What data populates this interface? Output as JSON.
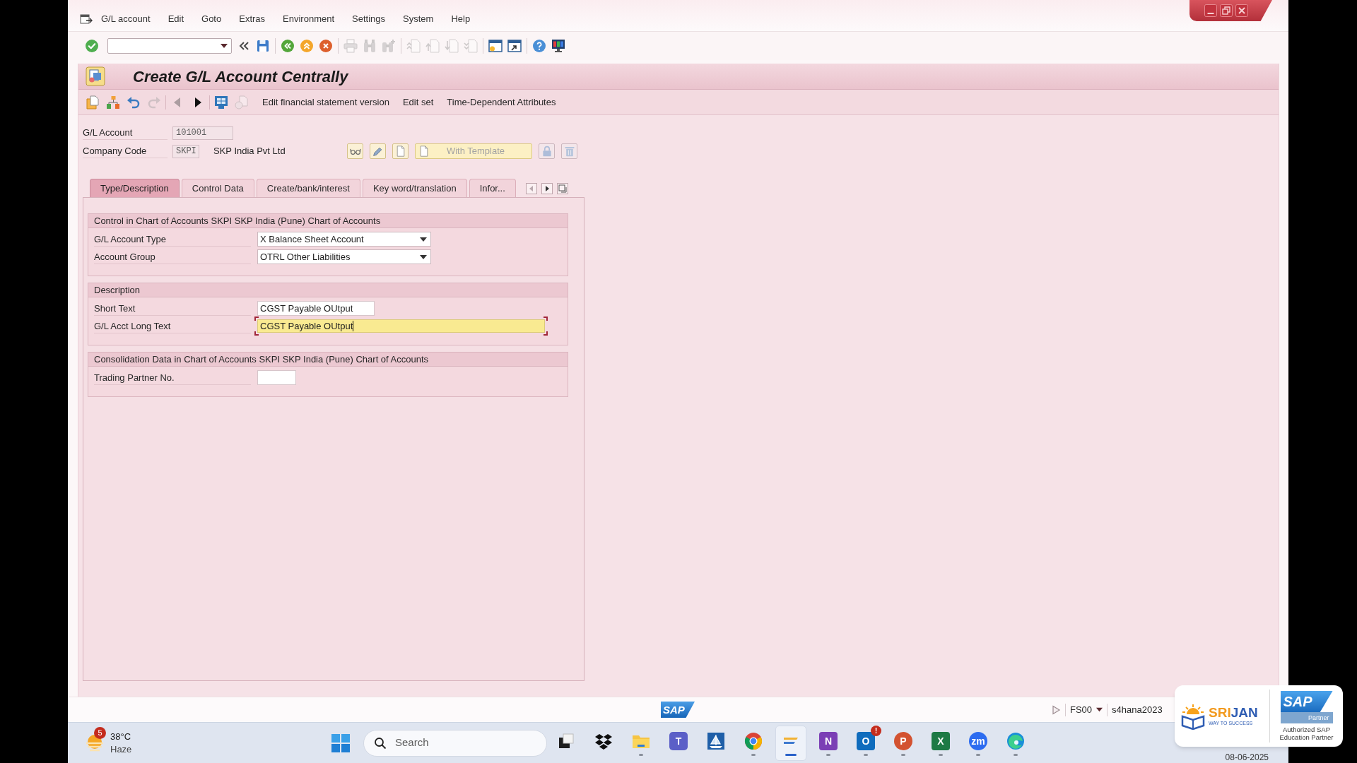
{
  "menu_bar": {
    "items": [
      "G/L account",
      "Edit",
      "Goto",
      "Extras",
      "Environment",
      "Settings",
      "System",
      "Help"
    ]
  },
  "standard_toolbar": {
    "groups": [
      [
        {
          "kind": "enter",
          "disabled": false
        },
        {
          "kind": "command_field",
          "disabled": false
        },
        {
          "kind": "collapse",
          "disabled": false
        },
        {
          "kind": "save",
          "disabled": false
        }
      ],
      [
        {
          "kind": "back",
          "disabled": false
        },
        {
          "kind": "exit",
          "disabled": false
        },
        {
          "kind": "cancel",
          "disabled": false
        }
      ],
      [
        {
          "kind": "print",
          "disabled": true
        },
        {
          "kind": "find",
          "disabled": true
        },
        {
          "kind": "find_next",
          "disabled": true
        }
      ],
      [
        {
          "kind": "first_page",
          "disabled": true
        },
        {
          "kind": "previous_page",
          "disabled": true
        },
        {
          "kind": "next_page",
          "disabled": true
        },
        {
          "kind": "last_page",
          "disabled": true
        }
      ],
      [
        {
          "kind": "new_session",
          "disabled": false
        },
        {
          "kind": "shortcut",
          "disabled": false
        }
      ],
      [
        {
          "kind": "help",
          "disabled": false
        },
        {
          "kind": "layout",
          "disabled": false
        }
      ]
    ]
  },
  "window": {
    "title": "Create G/L Account Centrally"
  },
  "app_toolbar": {
    "groups": [
      [
        {
          "kind": "paste",
          "disabled": false
        },
        {
          "kind": "hierarchy",
          "disabled": false
        },
        {
          "kind": "undo",
          "disabled": false
        },
        {
          "kind": "redo",
          "disabled": true
        }
      ],
      [
        {
          "kind": "previous",
          "disabled": true
        },
        {
          "kind": "next",
          "disabled": false
        }
      ],
      [
        {
          "kind": "display",
          "disabled": false
        },
        {
          "kind": "documents",
          "disabled": true
        },
        {
          "kind": "text",
          "label": "Edit financial statement version",
          "disabled": false
        },
        {
          "kind": "text",
          "label": "Edit set",
          "disabled": false
        },
        {
          "kind": "text",
          "label": "Time-Dependent Attributes",
          "disabled": false
        }
      ]
    ]
  },
  "header": {
    "fields": [
      {
        "label": "G/L Account",
        "value": "101001"
      },
      {
        "label": "Company Code",
        "value": "SKPI",
        "description": "SKP India Pvt Ltd"
      }
    ],
    "buttons": [
      {
        "kind": "display_change",
        "disabled": false
      },
      {
        "kind": "edit",
        "disabled": false
      },
      {
        "kind": "create",
        "disabled": false
      },
      {
        "kind": "template",
        "label": "With Template",
        "disabled": true
      },
      {
        "kind": "lock",
        "disabled": true
      },
      {
        "kind": "delete",
        "disabled": true
      }
    ]
  },
  "tabs": {
    "items": [
      {
        "label": "Type/Description",
        "selected": true
      },
      {
        "label": "Control Data",
        "selected": false
      },
      {
        "label": "Create/bank/interest",
        "selected": false
      },
      {
        "label": "Key word/translation",
        "selected": false
      },
      {
        "label": "Infor...",
        "selected": false
      }
    ]
  },
  "groups": [
    {
      "title": "Control in Chart of Accounts SKPI SKP India (Pune) Chart of Accounts",
      "fields": [
        {
          "label": "G/L Account Type",
          "kind": "dropdown",
          "value": "X Balance Sheet Account",
          "focused": false
        },
        {
          "label": "Account Group",
          "kind": "dropdown",
          "value": "OTRL Other Liabilities",
          "focused": false
        }
      ]
    },
    {
      "title": "Description",
      "fields": [
        {
          "label": "Short Text",
          "kind": "text",
          "value": "CGST Payable OUtput",
          "focused": false
        },
        {
          "label": "G/L Acct Long Text",
          "kind": "long_text",
          "value": "CGST Payable OUtput",
          "focused": true
        }
      ]
    },
    {
      "title": "Consolidation Data in Chart of Accounts SKPI SKP India (Pune) Chart of Accounts",
      "fields": [
        {
          "label": "Trading Partner No.",
          "kind": "code",
          "focused": false
        }
      ]
    }
  ],
  "status_bar": {
    "logo": "SAP",
    "transaction": "FS00",
    "system": "s4hana2023"
  },
  "taskbar": {
    "weather": {
      "badge": "5",
      "temperature": "38°C",
      "condition": "Haze"
    },
    "search": {
      "placeholder": "Search"
    },
    "apps": [
      {
        "kind": "task_view",
        "running": false,
        "active": false
      },
      {
        "kind": "box_sync",
        "running": false,
        "active": false
      },
      {
        "kind": "folder",
        "running": true,
        "active": false
      },
      {
        "kind": "team_chat",
        "glyph": "T",
        "running": false,
        "active": false
      },
      {
        "kind": "ship",
        "running": false,
        "active": false
      },
      {
        "kind": "browser_round",
        "running": true,
        "active": false
      },
      {
        "kind": "erp_logon",
        "running": true,
        "active": true
      },
      {
        "kind": "notebook",
        "glyph": "N",
        "running": true,
        "active": false
      },
      {
        "kind": "mail",
        "glyph": "O",
        "badge": "!",
        "running": true,
        "active": false
      },
      {
        "kind": "slides",
        "glyph": "P",
        "running": true,
        "active": false
      },
      {
        "kind": "sheet",
        "glyph": "X",
        "running": true,
        "active": false
      },
      {
        "kind": "video_meeting",
        "glyph": "zm",
        "running": true,
        "active": false
      },
      {
        "kind": "browser_wave",
        "running": true,
        "active": false
      }
    ],
    "date": "08-06-2025"
  },
  "partner_badge": {
    "brand": [
      "SRI",
      "JAN"
    ],
    "tagline": "WAY TO SUCCESS",
    "logo": "SAP",
    "tier": "Partner",
    "caption": "Authorized SAP Education Partner"
  }
}
